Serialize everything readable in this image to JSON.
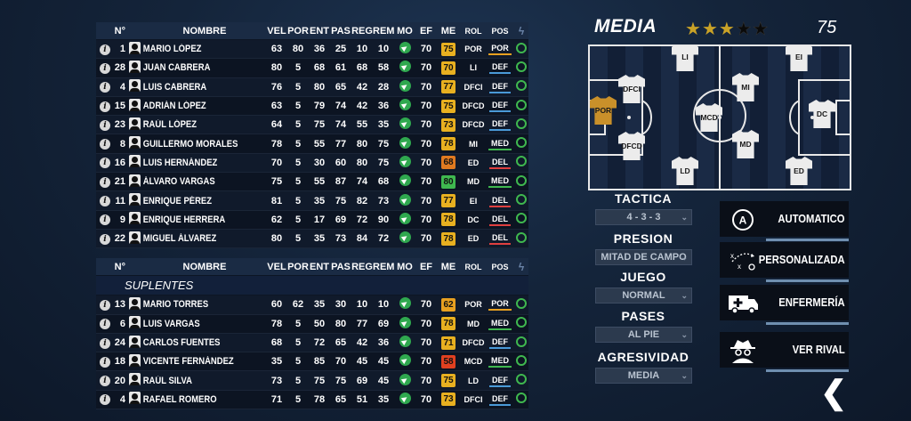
{
  "headers": {
    "num": "N°",
    "name": "NOMBRE",
    "vel": "VEL",
    "por": "POR",
    "ent": "ENT",
    "pas": "PAS",
    "reg": "REG",
    "rem": "REM",
    "mo": "MO",
    "ef": "EF",
    "me": "ME",
    "rol": "ROL",
    "pos": "POS"
  },
  "starters": [
    {
      "num": "1",
      "name": "MARIO LÓPEZ",
      "vel": "63",
      "por": "80",
      "ent": "36",
      "pas": "25",
      "reg": "10",
      "rem": "10",
      "ef": "70",
      "me": "75",
      "me_color": "#e8b020",
      "rol": "POR",
      "pos": "POR",
      "pos_color": "#e8a020"
    },
    {
      "num": "28",
      "name": "JUAN CABRERA",
      "vel": "80",
      "por": "5",
      "ent": "68",
      "pas": "61",
      "reg": "68",
      "rem": "58",
      "ef": "70",
      "me": "70",
      "me_color": "#e8b020",
      "rol": "LI",
      "pos": "DEF",
      "pos_color": "#4a9ad8"
    },
    {
      "num": "4",
      "name": "LUIS CABRERA",
      "vel": "76",
      "por": "5",
      "ent": "80",
      "pas": "65",
      "reg": "42",
      "rem": "28",
      "ef": "70",
      "me": "77",
      "me_color": "#e8b020",
      "rol": "DFCI",
      "pos": "DEF",
      "pos_color": "#4a9ad8"
    },
    {
      "num": "15",
      "name": "ADRIÁN LÓPEZ",
      "vel": "63",
      "por": "5",
      "ent": "79",
      "pas": "74",
      "reg": "42",
      "rem": "36",
      "ef": "70",
      "me": "75",
      "me_color": "#e8b020",
      "rol": "DFCD",
      "pos": "DEF",
      "pos_color": "#4a9ad8"
    },
    {
      "num": "23",
      "name": "RAÚL LÓPEZ",
      "vel": "64",
      "por": "5",
      "ent": "75",
      "pas": "74",
      "reg": "55",
      "rem": "35",
      "ef": "70",
      "me": "73",
      "me_color": "#e8b020",
      "rol": "DFCD",
      "pos": "DEF",
      "pos_color": "#4a9ad8"
    },
    {
      "num": "8",
      "name": "GUILLERMO MORALES",
      "vel": "78",
      "por": "5",
      "ent": "55",
      "pas": "77",
      "reg": "80",
      "rem": "75",
      "ef": "70",
      "me": "78",
      "me_color": "#e8b020",
      "rol": "MI",
      "pos": "MED",
      "pos_color": "#3fb84f"
    },
    {
      "num": "16",
      "name": "LUIS HERNÁNDEZ",
      "vel": "70",
      "por": "5",
      "ent": "30",
      "pas": "60",
      "reg": "80",
      "rem": "75",
      "ef": "70",
      "me": "68",
      "me_color": "#e07a20",
      "rol": "ED",
      "pos": "DEL",
      "pos_color": "#e04040"
    },
    {
      "num": "21",
      "name": "ÁLVARO VARGAS",
      "vel": "75",
      "por": "5",
      "ent": "55",
      "pas": "87",
      "reg": "74",
      "rem": "68",
      "ef": "70",
      "me": "80",
      "me_color": "#3fb84f",
      "rol": "MD",
      "pos": "MED",
      "pos_color": "#3fb84f"
    },
    {
      "num": "11",
      "name": "ENRIQUE PÉREZ",
      "vel": "81",
      "por": "5",
      "ent": "35",
      "pas": "75",
      "reg": "82",
      "rem": "73",
      "ef": "70",
      "me": "77",
      "me_color": "#e8b020",
      "rol": "EI",
      "pos": "DEL",
      "pos_color": "#e04040"
    },
    {
      "num": "9",
      "name": "ENRIQUE HERRERA",
      "vel": "62",
      "por": "5",
      "ent": "17",
      "pas": "69",
      "reg": "72",
      "rem": "90",
      "ef": "70",
      "me": "78",
      "me_color": "#e8b020",
      "rol": "DC",
      "pos": "DEL",
      "pos_color": "#e04040"
    },
    {
      "num": "22",
      "name": "MIGUEL ÁLVAREZ",
      "vel": "80",
      "por": "5",
      "ent": "35",
      "pas": "73",
      "reg": "84",
      "rem": "72",
      "ef": "70",
      "me": "78",
      "me_color": "#e8b020",
      "rol": "ED",
      "pos": "DEL",
      "pos_color": "#e04040"
    }
  ],
  "subs_label": "SUPLENTES",
  "subs": [
    {
      "num": "13",
      "name": "MARIO TORRES",
      "vel": "60",
      "por": "62",
      "ent": "35",
      "pas": "30",
      "reg": "10",
      "rem": "10",
      "ef": "70",
      "me": "62",
      "me_color": "#e8a020",
      "rol": "POR",
      "pos": "POR",
      "pos_color": "#e8a020"
    },
    {
      "num": "6",
      "name": "LUIS VARGAS",
      "vel": "78",
      "por": "5",
      "ent": "50",
      "pas": "80",
      "reg": "77",
      "rem": "69",
      "ef": "70",
      "me": "78",
      "me_color": "#e8b020",
      "rol": "MD",
      "pos": "MED",
      "pos_color": "#3fb84f"
    },
    {
      "num": "24",
      "name": "CARLOS FUENTES",
      "vel": "68",
      "por": "5",
      "ent": "72",
      "pas": "65",
      "reg": "42",
      "rem": "36",
      "ef": "70",
      "me": "71",
      "me_color": "#e8b020",
      "rol": "DFCD",
      "pos": "DEF",
      "pos_color": "#4a9ad8"
    },
    {
      "num": "18",
      "name": "VICENTE FERNÁNDEZ",
      "vel": "35",
      "por": "5",
      "ent": "85",
      "pas": "70",
      "reg": "45",
      "rem": "45",
      "ef": "70",
      "me": "58",
      "me_color": "#e04020",
      "rol": "MCD",
      "pos": "MED",
      "pos_color": "#3fb84f"
    },
    {
      "num": "20",
      "name": "RAÚL SILVA",
      "vel": "73",
      "por": "5",
      "ent": "75",
      "pas": "75",
      "reg": "69",
      "rem": "45",
      "ef": "70",
      "me": "75",
      "me_color": "#e8b020",
      "rol": "LD",
      "pos": "DEF",
      "pos_color": "#4a9ad8"
    },
    {
      "num": "4",
      "name": "RAFAEL ROMERO",
      "vel": "71",
      "por": "5",
      "ent": "78",
      "pas": "65",
      "reg": "51",
      "rem": "35",
      "ef": "70",
      "me": "73",
      "me_color": "#e8b020",
      "rol": "DFCI",
      "pos": "DEF",
      "pos_color": "#4a9ad8"
    }
  ],
  "media": {
    "label": "MEDIA",
    "stars_filled": 3,
    "stars_total": 5,
    "value": "75"
  },
  "pitch_positions": [
    "POR",
    "DFCI",
    "DFCD",
    "LI",
    "LD",
    "MCD",
    "MI",
    "MD",
    "EI",
    "DC",
    "ED"
  ],
  "options": [
    {
      "label": "TACTICA",
      "value": "4 - 3 - 3"
    },
    {
      "label": "PRESION",
      "value": "MITAD DE CAMPO"
    },
    {
      "label": "JUEGO",
      "value": "NORMAL"
    },
    {
      "label": "PASES",
      "value": "AL PIE"
    },
    {
      "label": "AGRESIVIDAD",
      "value": "MEDIA"
    }
  ],
  "actions": [
    {
      "label": "AUTOMATICO",
      "icon": "auto-icon"
    },
    {
      "label": "PERSONALIZADA",
      "icon": "tactic-board-icon"
    },
    {
      "label": "ENFERMERÍA",
      "icon": "ambulance-icon"
    },
    {
      "label": "VER RIVAL",
      "icon": "spy-icon"
    }
  ],
  "back_glyph": "❮",
  "colors": {
    "gold": "#e8b020",
    "green": "#3fb84f",
    "red": "#e04040",
    "blue": "#4a9ad8"
  }
}
